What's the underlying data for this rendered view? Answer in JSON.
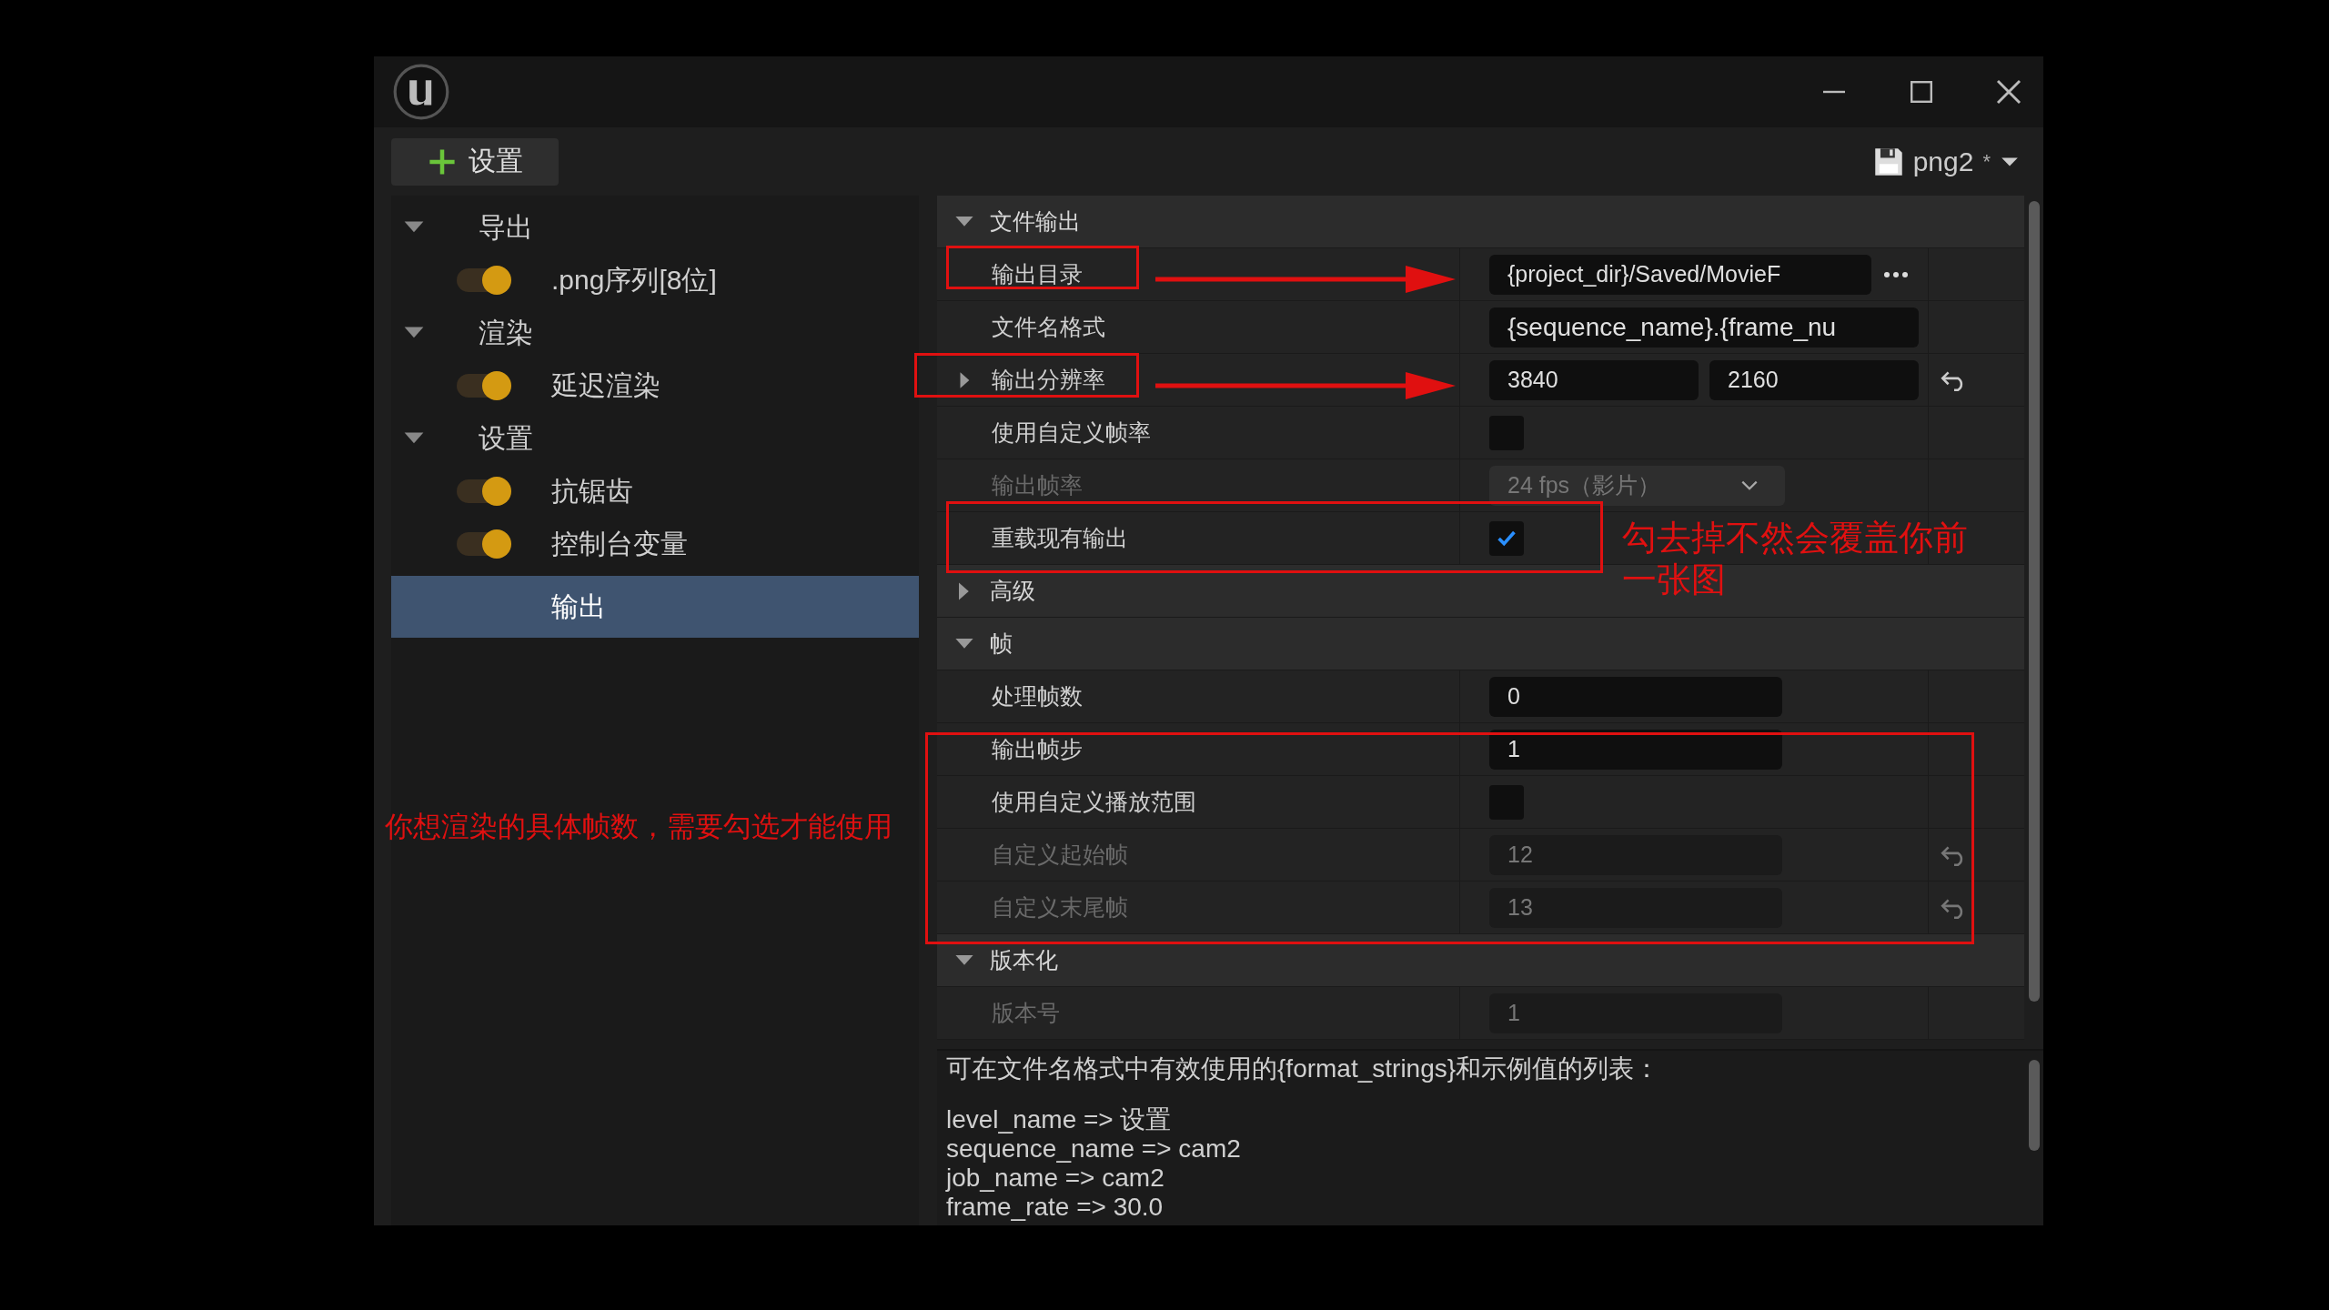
{
  "toolbar": {
    "add_button": "设置",
    "preset": "png2",
    "modified_mark": "*"
  },
  "tree": [
    {
      "label": "导出",
      "expanded": true,
      "children": [
        {
          "label": ".png序列[8位]",
          "kind": "toggle",
          "enabled": true,
          "selected": false
        }
      ]
    },
    {
      "label": "渲染",
      "expanded": true,
      "children": [
        {
          "label": "延迟渲染",
          "kind": "toggle",
          "enabled": true,
          "selected": false
        }
      ]
    },
    {
      "label": "设置",
      "expanded": true,
      "children": [
        {
          "label": "抗锯齿",
          "kind": "toggle",
          "enabled": true,
          "selected": false
        },
        {
          "label": "控制台变量",
          "kind": "toggle",
          "enabled": true,
          "selected": false
        },
        {
          "label": "输出",
          "kind": "plain",
          "selected": true
        }
      ]
    }
  ],
  "sections": [
    {
      "title": "文件输出",
      "expanded": true,
      "rows": [
        {
          "label": "输出目录",
          "kind": "path",
          "value": "{project_dir}/Saved/MovieF",
          "disabled": false,
          "reset": false,
          "expandable": false
        },
        {
          "label": "文件名格式",
          "kind": "text",
          "value": "{sequence_name}.{frame_nu",
          "disabled": false,
          "reset": false,
          "expandable": false
        },
        {
          "label": "输出分辨率",
          "kind": "pair",
          "values": [
            "3840",
            "2160"
          ],
          "disabled": false,
          "reset": true,
          "expandable": true
        },
        {
          "label": "使用自定义帧率",
          "kind": "checkbox",
          "checked": false,
          "disabled": false,
          "reset": false,
          "expandable": false
        },
        {
          "label": "输出帧率",
          "kind": "dropdown",
          "value": "24 fps（影片）",
          "disabled": true,
          "reset": false,
          "expandable": false
        },
        {
          "label": "重载现有输出",
          "kind": "checkbox",
          "checked": true,
          "disabled": false,
          "reset": false,
          "expandable": false
        }
      ]
    },
    {
      "title": "高级",
      "expanded": false
    },
    {
      "title": "帧",
      "expanded": true,
      "rows": [
        {
          "label": "处理帧数",
          "kind": "number",
          "value": "0",
          "disabled": false,
          "reset": false,
          "expandable": false
        },
        {
          "label": "输出帧步",
          "kind": "number",
          "value": "1",
          "disabled": false,
          "reset": false,
          "expandable": false
        },
        {
          "label": "使用自定义播放范围",
          "kind": "checkbox",
          "checked": false,
          "disabled": false,
          "reset": false,
          "expandable": false
        },
        {
          "label": "自定义起始帧",
          "kind": "number",
          "value": "12",
          "disabled": true,
          "reset": true,
          "expandable": false
        },
        {
          "label": "自定义末尾帧",
          "kind": "number",
          "value": "13",
          "disabled": true,
          "reset": true,
          "expandable": false
        }
      ]
    },
    {
      "title": "版本化",
      "expanded": true,
      "rows": [
        {
          "label": "版本号",
          "kind": "number",
          "value": "1",
          "disabled": true,
          "reset": false,
          "expandable": false
        }
      ]
    }
  ],
  "description": {
    "heading": "可在文件名格式中有效使用的{format_strings}和示例值的列表：",
    "lines": [
      "level_name => 设置",
      "sequence_name => cam2",
      "job_name => cam2",
      "frame_rate => 30.0"
    ]
  },
  "annotations": [
    "勾去掉不然会覆盖你前一张图",
    "你想渲染的具体帧数，需要勾选才能使用"
  ]
}
